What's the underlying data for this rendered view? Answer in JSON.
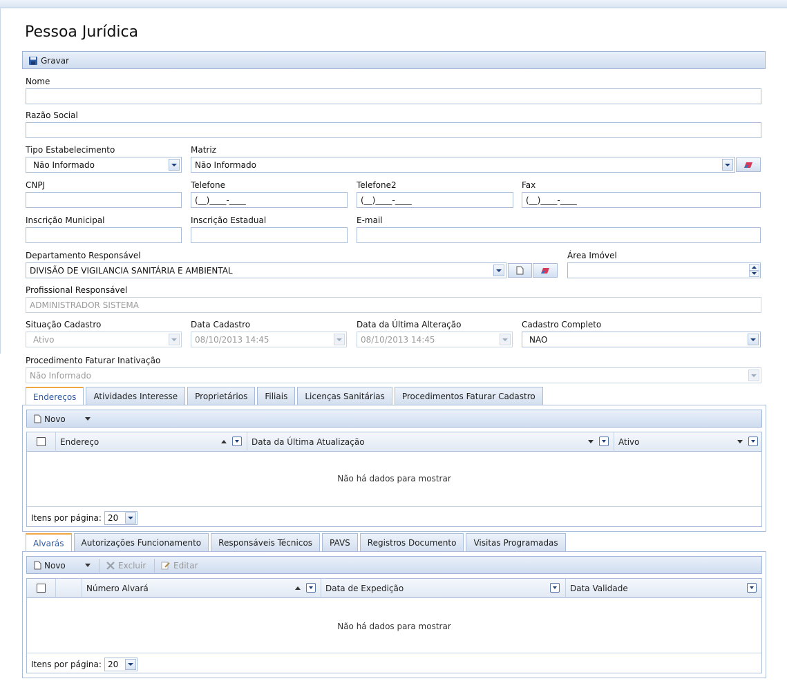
{
  "page": {
    "title": "Pessoa Jurídica"
  },
  "toolbar": {
    "save_label": "Gravar"
  },
  "form": {
    "nome": {
      "label": "Nome",
      "value": ""
    },
    "razao_social": {
      "label": "Razão Social",
      "value": ""
    },
    "tipo_estabelecimento": {
      "label": "Tipo Estabelecimento",
      "value": "Não Informado"
    },
    "matriz": {
      "label": "Matriz",
      "value": "Não Informado"
    },
    "cnpj": {
      "label": "CNPJ",
      "value": ""
    },
    "telefone": {
      "label": "Telefone",
      "value": "(__)____-____"
    },
    "telefone2": {
      "label": "Telefone2",
      "value": "(__)____-____"
    },
    "fax": {
      "label": "Fax",
      "value": "(__)____-____"
    },
    "inscricao_municipal": {
      "label": "Inscrição Municipal",
      "value": ""
    },
    "inscricao_estadual": {
      "label": "Inscrição Estadual",
      "value": ""
    },
    "email": {
      "label": "E-mail",
      "value": ""
    },
    "departamento": {
      "label": "Departamento Responsável",
      "value": "DIVISÃO DE VIGILANCIA SANITÁRIA E AMBIENTAL"
    },
    "area_imovel": {
      "label": "Área Imóvel",
      "value": ""
    },
    "profissional": {
      "label": "Profissional Responsável",
      "value": "ADMINISTRADOR SISTEMA"
    },
    "situacao": {
      "label": "Situação Cadastro",
      "value": "Ativo"
    },
    "data_cadastro": {
      "label": "Data Cadastro",
      "value": "08/10/2013 14:45"
    },
    "data_alteracao": {
      "label": "Data da Última Alteração",
      "value": "08/10/2013 14:45"
    },
    "cadastro_completo": {
      "label": "Cadastro Completo",
      "value": "NAO"
    },
    "procedimento_inativacao": {
      "label": "Procedimento Faturar Inativação",
      "value": "Não Informado"
    }
  },
  "tabs1": {
    "items": [
      "Endereços",
      "Atividades Interesse",
      "Proprietários",
      "Filiais",
      "Licenças Sanitárias",
      "Procedimentos Faturar Cadastro"
    ],
    "toolbar": {
      "new_label": "Novo"
    },
    "columns": [
      "Endereço",
      "Data da Última Atualização",
      "Ativo"
    ],
    "empty_text": "Não há dados para mostrar",
    "pager_label": "Itens por página:",
    "page_size": "20"
  },
  "tabs2": {
    "items": [
      "Alvarás",
      "Autorizações Funcionamento",
      "Responsáveis Técnicos",
      "PAVS",
      "Registros Documento",
      "Visitas Programadas"
    ],
    "toolbar": {
      "new_label": "Novo",
      "delete_label": "Excluir",
      "edit_label": "Editar"
    },
    "columns": [
      "Número Alvará",
      "Data de Expedição",
      "Data Validade"
    ],
    "empty_text": "Não há dados para mostrar",
    "pager_label": "Itens por página:",
    "page_size": "20"
  },
  "icons": {
    "save": "floppy-disk-icon",
    "eraser": "eraser-icon",
    "new": "new-document-icon",
    "delete": "x-icon",
    "edit": "pencil-icon"
  }
}
